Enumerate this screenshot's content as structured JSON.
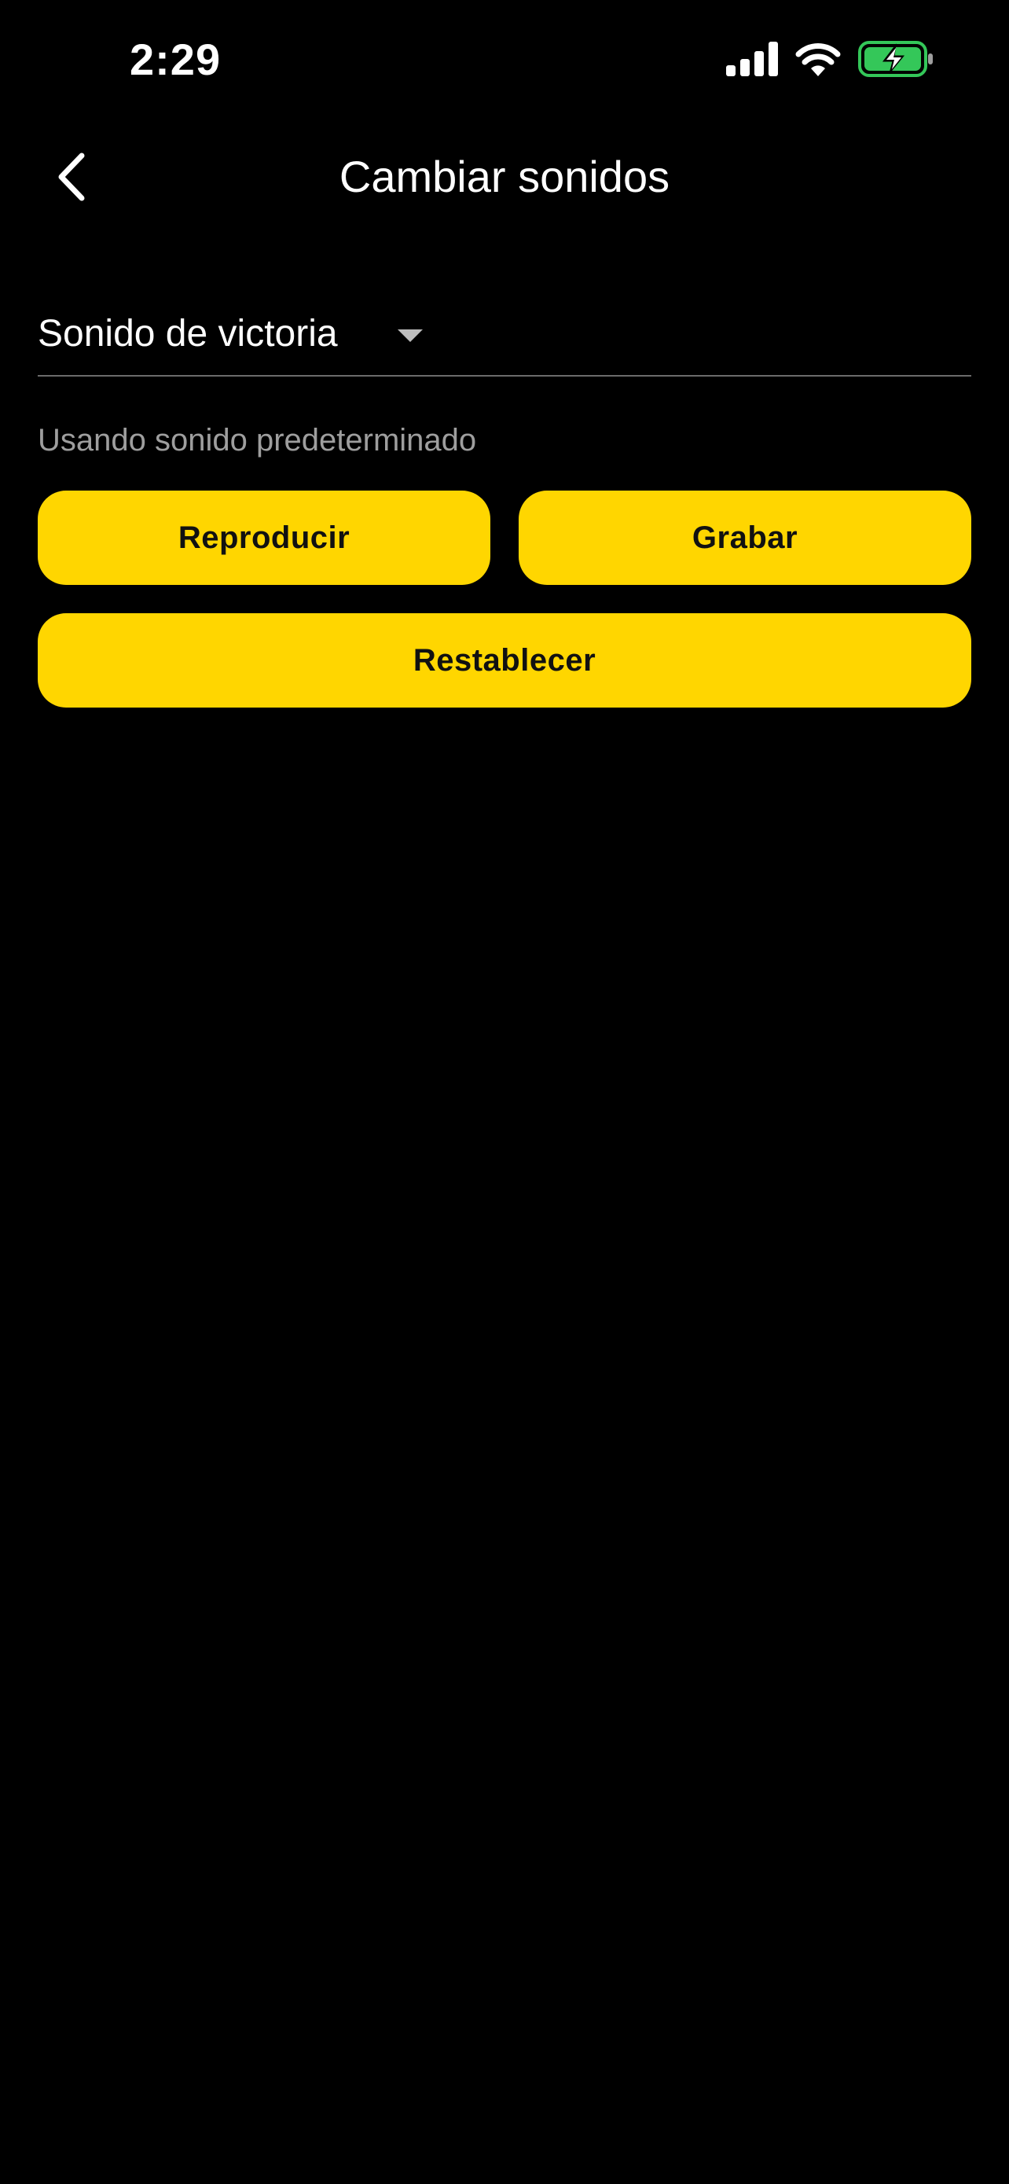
{
  "status_bar": {
    "time": "2:29",
    "icons": [
      "signal-icon",
      "wifi-icon",
      "battery-charging-icon"
    ],
    "battery_color": "#34c759"
  },
  "nav": {
    "title": "Cambiar sonidos",
    "back_icon": "chevron-left-icon"
  },
  "sound_select": {
    "selected": "Sonido de victoria",
    "caret_icon": "caret-down-icon"
  },
  "status_text": "Usando sonido predeterminado",
  "actions": {
    "play_label": "Reproducir",
    "record_label": "Grabar",
    "reset_label": "Restablecer"
  },
  "colors": {
    "background": "#000000",
    "accent": "#ffd600",
    "button_text": "#111111",
    "muted_text": "#9e9e9e"
  }
}
